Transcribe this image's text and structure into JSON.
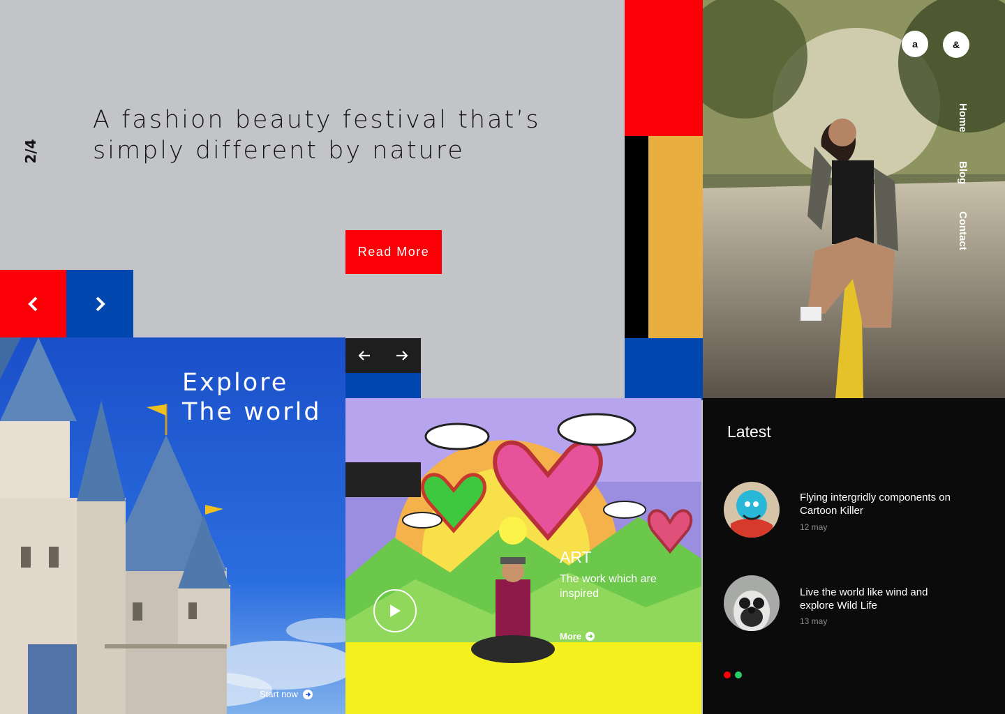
{
  "hero": {
    "counter": "2/4",
    "title": "A fashion beauty festival that’s simply different by nature",
    "read_more": "Read More"
  },
  "explore": {
    "title": "Explore\nThe world",
    "cta": "Start now"
  },
  "art": {
    "title": "ART",
    "subtitle": "The work which are inspired",
    "more": "More"
  },
  "header": {
    "circle_buttons": [
      "a",
      "&"
    ],
    "nav": [
      "Home",
      "Blog",
      "Contact"
    ]
  },
  "latest": {
    "title": "Latest",
    "posts": [
      {
        "title": "Flying intergridly components on Cartoon Killer",
        "date": "12 may"
      },
      {
        "title": "Live the world like wind and explore Wild Life",
        "date": "13 may"
      }
    ]
  },
  "colors": {
    "red": "#fb0007",
    "blue": "#0047b0",
    "yellow": "#e8af40",
    "black": "#000000",
    "gray": "#c3c4c8",
    "green_dot": "#27d26a"
  },
  "icons": {
    "slider_prev": "chevron-left-icon",
    "slider_next": "chevron-right-icon",
    "gallery_prev": "arrow-left-icon",
    "gallery_next": "arrow-right-icon",
    "play": "play-icon",
    "cta_arrow": "arrow-circle-right-icon"
  },
  "pager": {
    "active": 1,
    "count": 2
  }
}
